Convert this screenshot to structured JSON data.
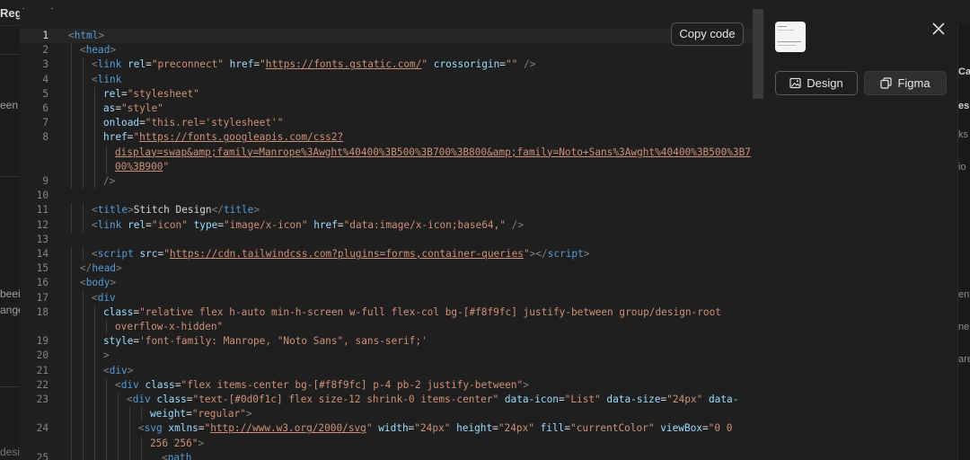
{
  "background": {
    "title_fragment": "Registratio",
    "fragments": [
      "een a",
      "beei",
      "angel",
      "desi"
    ],
    "right_fragments": [
      "Ca",
      "es",
      "ks",
      "io",
      "ent",
      "ne",
      "are"
    ]
  },
  "toolbar": {
    "copy_label": "Copy code"
  },
  "sidebar": {
    "design_label": "Design",
    "figma_label": "Figma",
    "design_icon": "image-icon",
    "figma_icon": "copy-icon",
    "close_icon": "close-icon"
  },
  "colors": {
    "tag": "#569cd6",
    "attr": "#9cdcfe",
    "string": "#ce9178",
    "text": "#d4d4d4",
    "gutter": "#858585"
  },
  "code": {
    "line_numbers": [
      "1",
      "2",
      "3",
      "4",
      "5",
      "6",
      "7",
      "8",
      "9",
      "10",
      "11",
      "12",
      "13",
      "14",
      "15",
      "16",
      "17",
      "18",
      "19",
      "20",
      "21",
      "22",
      "23",
      "24",
      "25"
    ],
    "lines": [
      [
        [
          "br",
          "<"
        ],
        [
          "tag",
          "html"
        ],
        [
          "br",
          ">"
        ]
      ],
      [
        [
          "br",
          "<"
        ],
        [
          "tag",
          "head"
        ],
        [
          "br",
          ">"
        ]
      ],
      [
        [
          "br",
          "<"
        ],
        [
          "tag",
          "link"
        ],
        [
          "txt",
          " "
        ],
        [
          "attr",
          "rel"
        ],
        [
          "txt",
          "="
        ],
        [
          "str",
          "\"preconnect\""
        ],
        [
          "txt",
          " "
        ],
        [
          "attr",
          "href"
        ],
        [
          "txt",
          "="
        ],
        [
          "str",
          "\""
        ],
        [
          "url",
          "https://fonts.gstatic.com/"
        ],
        [
          "str",
          "\""
        ],
        [
          "txt",
          " "
        ],
        [
          "attr",
          "crossorigin"
        ],
        [
          "txt",
          "="
        ],
        [
          "str",
          "\"\""
        ],
        [
          "txt",
          " "
        ],
        [
          "br",
          "/>"
        ]
      ],
      [
        [
          "br",
          "<"
        ],
        [
          "tag",
          "link"
        ]
      ],
      [
        [
          "attr",
          "rel"
        ],
        [
          "txt",
          "="
        ],
        [
          "str",
          "\"stylesheet\""
        ]
      ],
      [
        [
          "attr",
          "as"
        ],
        [
          "txt",
          "="
        ],
        [
          "str",
          "\"style\""
        ]
      ],
      [
        [
          "attr",
          "onload"
        ],
        [
          "txt",
          "="
        ],
        [
          "str",
          "\"this.rel='stylesheet'\""
        ]
      ],
      [
        [
          "attr",
          "href"
        ],
        [
          "txt",
          "="
        ],
        [
          "str",
          "\""
        ],
        [
          "url",
          "https://fonts.googleapis.com/css2?"
        ]
      ],
      [
        [
          "url",
          "display=swap&amp;family=Manrope%3Awght%40400%3B500%3B700%3B800&amp;family=Noto+Sans%3Awght%40400%3B500%3B7"
        ]
      ],
      [
        [
          "url",
          "00%3B900"
        ],
        [
          "str",
          "\""
        ]
      ],
      [
        [
          "br",
          "/>"
        ]
      ],
      [],
      [
        [
          "br",
          "<"
        ],
        [
          "tag",
          "title"
        ],
        [
          "br",
          ">"
        ],
        [
          "txt",
          "Stitch Design"
        ],
        [
          "br",
          "</"
        ],
        [
          "tag",
          "title"
        ],
        [
          "br",
          ">"
        ]
      ],
      [
        [
          "br",
          "<"
        ],
        [
          "tag",
          "link"
        ],
        [
          "txt",
          " "
        ],
        [
          "attr",
          "rel"
        ],
        [
          "txt",
          "="
        ],
        [
          "str",
          "\"icon\""
        ],
        [
          "txt",
          " "
        ],
        [
          "attr",
          "type"
        ],
        [
          "txt",
          "="
        ],
        [
          "str",
          "\"image/x-icon\""
        ],
        [
          "txt",
          " "
        ],
        [
          "attr",
          "href"
        ],
        [
          "txt",
          "="
        ],
        [
          "str",
          "\"data:image/x-icon;base64,\""
        ],
        [
          "txt",
          " "
        ],
        [
          "br",
          "/>"
        ]
      ],
      [],
      [
        [
          "br",
          "<"
        ],
        [
          "tag",
          "script"
        ],
        [
          "txt",
          " "
        ],
        [
          "attr",
          "src"
        ],
        [
          "txt",
          "="
        ],
        [
          "str",
          "\""
        ],
        [
          "url",
          "https://cdn.tailwindcss.com?plugins=forms,container-queries"
        ],
        [
          "str",
          "\""
        ],
        [
          "br",
          "></"
        ],
        [
          "tag",
          "script"
        ],
        [
          "br",
          ">"
        ]
      ],
      [
        [
          "br",
          "</"
        ],
        [
          "tag",
          "head"
        ],
        [
          "br",
          ">"
        ]
      ],
      [
        [
          "br",
          "<"
        ],
        [
          "tag",
          "body"
        ],
        [
          "br",
          ">"
        ]
      ],
      [
        [
          "br",
          "<"
        ],
        [
          "tag",
          "div"
        ]
      ],
      [
        [
          "attr",
          "class"
        ],
        [
          "txt",
          "="
        ],
        [
          "str",
          "\"relative flex h-auto min-h-screen w-full flex-col bg-[#f8f9fc] justify-between group/design-root"
        ]
      ],
      [
        [
          "str",
          "overflow-x-hidden\""
        ]
      ],
      [
        [
          "attr",
          "style"
        ],
        [
          "txt",
          "="
        ],
        [
          "str",
          "'font-family: Manrope, \"Noto Sans\", sans-serif;'"
        ]
      ],
      [
        [
          "br",
          ">"
        ]
      ],
      [
        [
          "br",
          "<"
        ],
        [
          "tag",
          "div"
        ],
        [
          "br",
          ">"
        ]
      ],
      [
        [
          "br",
          "<"
        ],
        [
          "tag",
          "div"
        ],
        [
          "txt",
          " "
        ],
        [
          "attr",
          "class"
        ],
        [
          "txt",
          "="
        ],
        [
          "str",
          "\"flex items-center bg-[#f8f9fc] p-4 pb-2 justify-between\""
        ],
        [
          "br",
          ">"
        ]
      ],
      [
        [
          "br",
          "<"
        ],
        [
          "tag",
          "div"
        ],
        [
          "txt",
          " "
        ],
        [
          "attr",
          "class"
        ],
        [
          "txt",
          "="
        ],
        [
          "str",
          "\"text-[#0d0f1c] flex size-12 shrink-0 items-center\""
        ],
        [
          "txt",
          " "
        ],
        [
          "attr",
          "data-icon"
        ],
        [
          "txt",
          "="
        ],
        [
          "str",
          "\"List\""
        ],
        [
          "txt",
          " "
        ],
        [
          "attr",
          "data-size"
        ],
        [
          "txt",
          "="
        ],
        [
          "str",
          "\"24px\""
        ],
        [
          "txt",
          " "
        ],
        [
          "attr",
          "data-"
        ]
      ],
      [
        [
          "attr",
          "weight"
        ],
        [
          "txt",
          "="
        ],
        [
          "str",
          "\"regular\""
        ],
        [
          "br",
          ">"
        ]
      ],
      [
        [
          "br",
          "<"
        ],
        [
          "tag",
          "svg"
        ],
        [
          "txt",
          " "
        ],
        [
          "attr",
          "xmlns"
        ],
        [
          "txt",
          "="
        ],
        [
          "str",
          "\""
        ],
        [
          "url",
          "http://www.w3.org/2000/svg"
        ],
        [
          "str",
          "\""
        ],
        [
          "txt",
          " "
        ],
        [
          "attr",
          "width"
        ],
        [
          "txt",
          "="
        ],
        [
          "str",
          "\"24px\""
        ],
        [
          "txt",
          " "
        ],
        [
          "attr",
          "height"
        ],
        [
          "txt",
          "="
        ],
        [
          "str",
          "\"24px\""
        ],
        [
          "txt",
          " "
        ],
        [
          "attr",
          "fill"
        ],
        [
          "txt",
          "="
        ],
        [
          "str",
          "\"currentColor\""
        ],
        [
          "txt",
          " "
        ],
        [
          "attr",
          "viewBox"
        ],
        [
          "txt",
          "="
        ],
        [
          "str",
          "\"0 0"
        ]
      ],
      [
        [
          "str",
          "256 256\""
        ],
        [
          "br",
          ">"
        ]
      ],
      [
        [
          "br",
          "<"
        ],
        [
          "tag",
          "path"
        ]
      ]
    ]
  }
}
